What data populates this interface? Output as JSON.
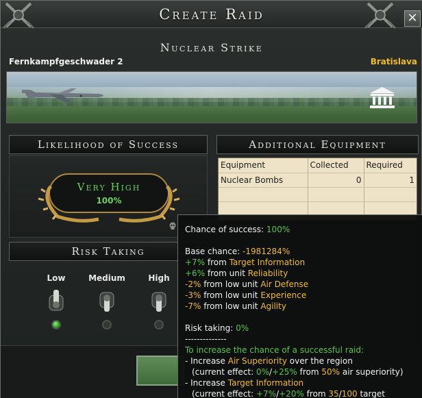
{
  "window": {
    "title": "Create Raid",
    "close_label": "✕"
  },
  "raid": {
    "type": "Nuclear Strike",
    "unit": "Fernkampfgeschwader 2",
    "target": "Bratislava"
  },
  "likelihood": {
    "header": "Likelihood of Success",
    "level": "Very High",
    "percent": "100%"
  },
  "equipment": {
    "header": "Additional Equipment",
    "columns": [
      "Equipment",
      "Collected",
      "Required"
    ],
    "rows": [
      {
        "name": "Nuclear Bombs",
        "collected": "0",
        "required": "1"
      }
    ]
  },
  "risk": {
    "header": "Risk Taking",
    "options": [
      {
        "label": "Low",
        "selected": true
      },
      {
        "label": "Medium",
        "selected": false
      },
      {
        "label": "High",
        "selected": false
      }
    ]
  },
  "tooltip": {
    "chance_label": "Chance of success: ",
    "chance_value": "100%",
    "base_label": "Base chance: ",
    "base_value": "-1981284%",
    "modifiers": [
      {
        "value": "+7%",
        "mid": " from ",
        "name": "Target Information",
        "sign": "pos"
      },
      {
        "value": "+6%",
        "mid": " from unit ",
        "name": "Reliability",
        "sign": "pos"
      },
      {
        "value": "-2%",
        "mid": " from low unit ",
        "name": "Air Defense",
        "sign": "neg"
      },
      {
        "value": "-3%",
        "mid": " from low unit ",
        "name": "Experience",
        "sign": "neg"
      },
      {
        "value": "-7%",
        "mid": " from low unit ",
        "name": "Agility",
        "sign": "neg"
      }
    ],
    "risk_label": "Risk taking: ",
    "risk_value": "0%",
    "separator": "--------------",
    "increase_header": "To increase the chance of a successful raid:",
    "tips": [
      {
        "prefix": "- Increase ",
        "name": "Air Superiority",
        "suffix": " over the region",
        "effect_prefix": "(current effect: ",
        "effect_a": "0%",
        "effect_slash": "/",
        "effect_b": "+25%",
        "effect_mid": " from ",
        "effect_c": "50%",
        "effect_suffix": " air superiority)"
      },
      {
        "prefix": "- Increase ",
        "name": "Target Information",
        "suffix": "",
        "effect_prefix": "(current effect: ",
        "effect_a": "+7%",
        "effect_slash": "/",
        "effect_b": "+20%",
        "effect_mid": " from ",
        "effect_c": "35",
        "effect_c2": "/",
        "effect_d": "100",
        "effect_suffix": " target"
      }
    ]
  },
  "colors": {
    "positive": "#58c34a",
    "highlight": "#f2bb20",
    "likelihood": "#6fcf5e"
  }
}
